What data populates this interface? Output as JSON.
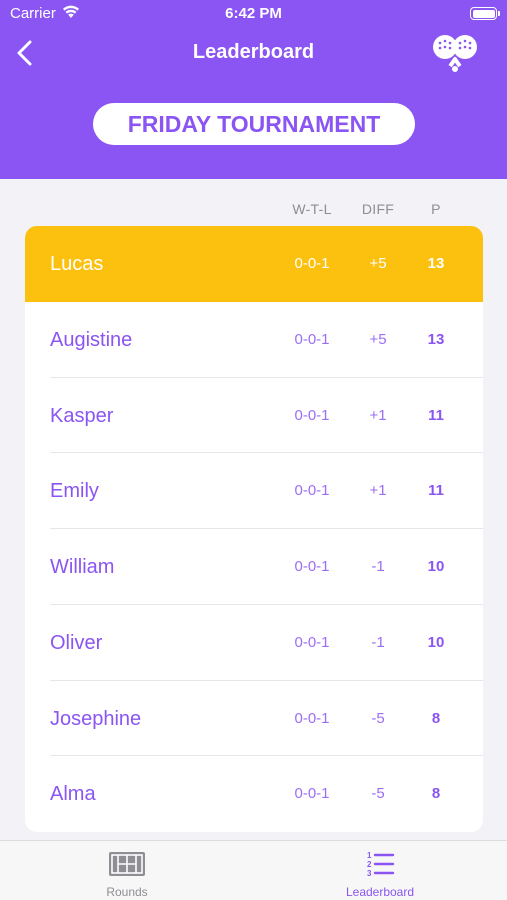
{
  "status_bar": {
    "carrier": "Carrier",
    "time": "6:42 PM"
  },
  "nav": {
    "title": "Leaderboard",
    "back_icon": "chevron-left-icon",
    "action_icon": "padel-rackets-icon"
  },
  "tournament": {
    "name": "FRIDAY TOURNAMENT"
  },
  "columns": {
    "wtl": "W-T-L",
    "diff": "DIFF",
    "points": "P"
  },
  "players": [
    {
      "name": "Lucas",
      "wtl": "0-0-1",
      "diff": "+5",
      "points": "13"
    },
    {
      "name": "Augistine",
      "wtl": "0-0-1",
      "diff": "+5",
      "points": "13"
    },
    {
      "name": "Kasper",
      "wtl": "0-0-1",
      "diff": "+1",
      "points": "11"
    },
    {
      "name": "Emily",
      "wtl": "0-0-1",
      "diff": "+1",
      "points": "11"
    },
    {
      "name": "William",
      "wtl": "0-0-1",
      "diff": "-1",
      "points": "10"
    },
    {
      "name": "Oliver",
      "wtl": "0-0-1",
      "diff": "-1",
      "points": "10"
    },
    {
      "name": "Josephine",
      "wtl": "0-0-1",
      "diff": "-5",
      "points": "8"
    },
    {
      "name": "Alma",
      "wtl": "0-0-1",
      "diff": "-5",
      "points": "8"
    }
  ],
  "tabs": [
    {
      "label": "Rounds",
      "icon": "court-icon",
      "active": false
    },
    {
      "label": "Leaderboard",
      "icon": "ranked-list-icon",
      "active": true
    }
  ],
  "colors": {
    "accent": "#8a55f2",
    "leader_highlight": "#fcc10e",
    "background": "#f2f2f7"
  }
}
